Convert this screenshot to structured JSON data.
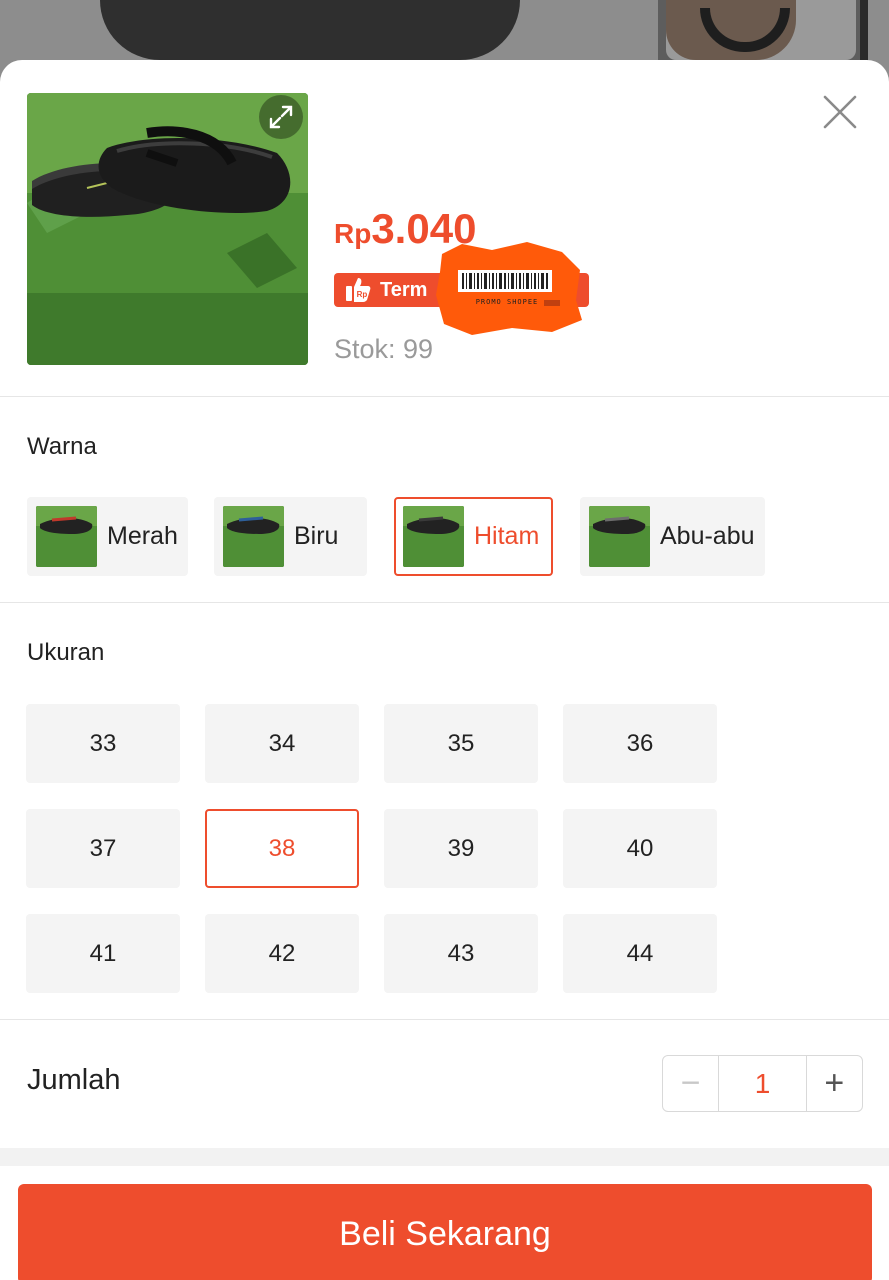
{
  "product": {
    "price_currency": "Rp",
    "price_amount": "3.040",
    "promo_badge_text": "Term",
    "sticker_text": "PROMO SHOPEE",
    "stock_text": "Stok: 99"
  },
  "variants": {
    "color_label": "Warna",
    "colors": [
      {
        "label": "Merah",
        "accent": "#c0392b"
      },
      {
        "label": "Biru",
        "accent": "#2e5f9a"
      },
      {
        "label": "Hitam",
        "accent": "#222222"
      },
      {
        "label": "Abu-abu",
        "accent": "#6d6d6d"
      }
    ],
    "selected_color": "Hitam",
    "size_label": "Ukuran",
    "sizes": [
      "33",
      "34",
      "35",
      "36",
      "37",
      "38",
      "39",
      "40",
      "41",
      "42",
      "43",
      "44"
    ],
    "selected_size": "38"
  },
  "quantity": {
    "label": "Jumlah",
    "value": "1",
    "minus_symbol": "−",
    "plus_symbol": "+"
  },
  "buy_button_label": "Beli Sekarang",
  "icons": {
    "expand": "expand-icon",
    "close": "close-icon",
    "promo": "rp-thumb-icon"
  },
  "colors": {
    "accent": "#ee4d2d",
    "option_bg": "#f4f4f4",
    "muted_text": "#9a9a9a"
  }
}
